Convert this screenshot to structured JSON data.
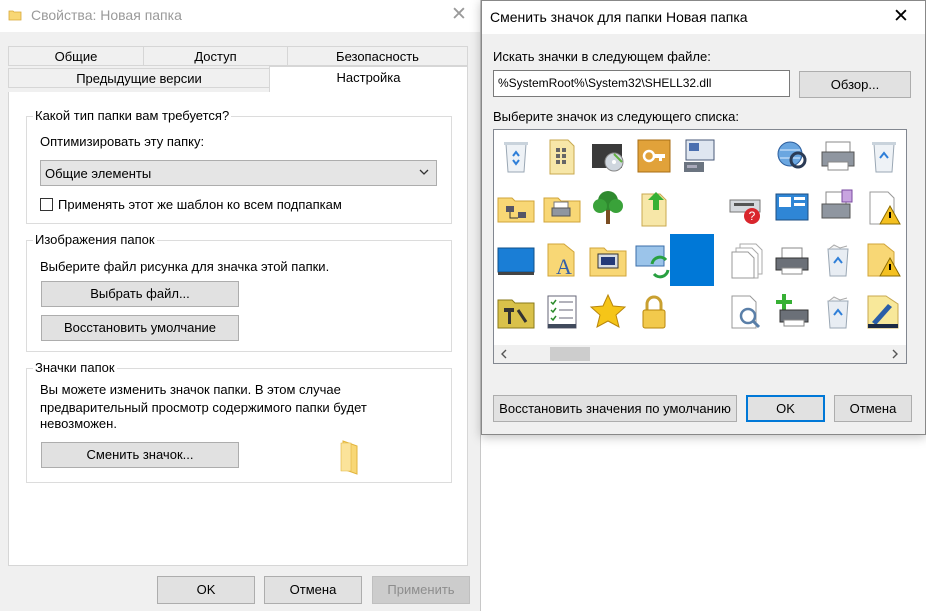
{
  "properties_window": {
    "title": "Свойства: Новая папка",
    "tabs_row1": [
      "Общие",
      "Доступ",
      "Безопасность"
    ],
    "tabs_row2": [
      "Предыдущие версии",
      "Настройка"
    ],
    "active_tab": "Настройка",
    "folder_type_group": {
      "title": "Какой тип папки вам требуется?",
      "optimize_label": "Оптимизировать эту папку:",
      "optimize_value": "Общие элементы",
      "apply_template_label": "Применять этот же шаблон ко всем подпапкам",
      "apply_template_checked": false
    },
    "folder_pictures_group": {
      "title": "Изображения папок",
      "description": "Выберите файл рисунка для значка этой папки.",
      "choose_file_button": "Выбрать файл...",
      "restore_default_button": "Восстановить умолчание"
    },
    "folder_icons_group": {
      "title": "Значки папок",
      "description_lines": [
        "Вы можете изменить значок папки. В этом случае",
        "предварительный просмотр содержимого папки будет",
        "невозможен."
      ],
      "change_icon_button": "Сменить значок..."
    },
    "footer": {
      "ok": "OK",
      "cancel": "Отмена",
      "apply": "Применить"
    }
  },
  "change_icon_dialog": {
    "title": "Сменить значок для папки Новая папка",
    "search_label": "Искать значки в следующем файле:",
    "file_path": "%SystemRoot%\\System32\\SHELL32.dll",
    "browse_button": "Обзор...",
    "list_label": "Выберите значок из следующего списка:",
    "icons": [
      "recycle-bin-empty-icon",
      "document-grid-icon",
      "dvd-drive-icon",
      "key-icon",
      "computer-window-icon",
      "",
      "search-globe-icon",
      "printer-icon",
      "recycle-bin-icon",
      "folder-network-icon",
      "folder-printer-icon",
      "tree-icon",
      "upload-document-icon",
      "",
      "network-error-icon",
      "control-panel-icon",
      "printer-document-icon",
      "document-warning-icon",
      "monitor-blue-icon",
      "folder-font-icon",
      "folder-computer-icon",
      "sync-icon",
      "blue-square-icon",
      "documents-stack-icon",
      "printer-gray-icon",
      "recycle-bin-full-icon",
      "folder-warning-icon",
      "folder-tools-icon",
      "checklist-icon",
      "star-icon",
      "lock-icon",
      "",
      "document-search-icon",
      "printer-add-icon",
      "recycle-bin-full-icon",
      "folder-pen-icon"
    ],
    "selected_icon_index": 22,
    "restore_defaults_button": "Восстановить значения по умолчанию",
    "ok": "OK",
    "cancel": "Отмена",
    "colors": {
      "accent": "#0078d7",
      "selection": "#0078d7",
      "folder_yellow": "#f8d775"
    }
  }
}
